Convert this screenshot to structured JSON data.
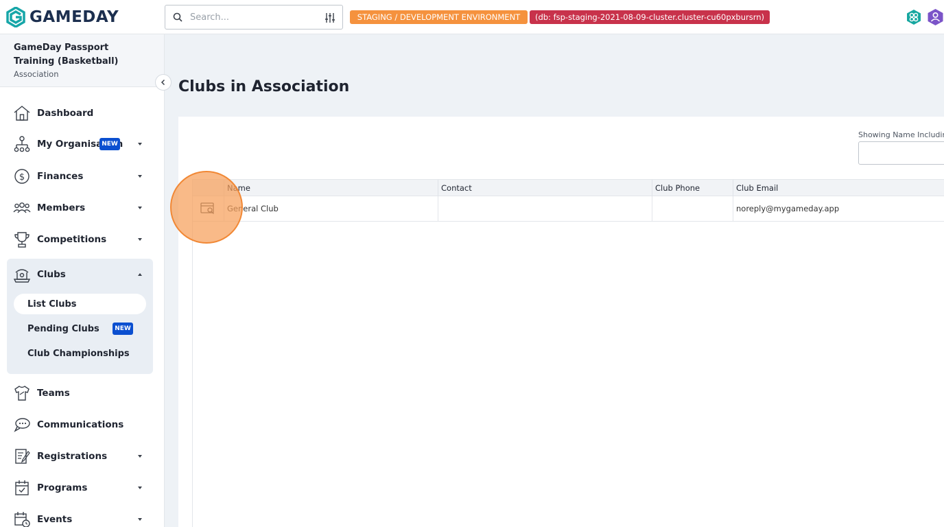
{
  "header": {
    "logo_text": "GAMEDAY",
    "search_placeholder": "Search...",
    "env_badge": "STAGING / DEVELOPMENT ENVIRONMENT",
    "db_badge": "(db: fsp-staging-2021-08-09-cluster.cluster-cu60pxbursrn)",
    "colors": {
      "env": "#f5923e",
      "db": "#c8324b",
      "brand": "#1c2f4f"
    }
  },
  "sidebar": {
    "org_name": "GameDay Passport Training (Basketball)",
    "org_type": "Association",
    "items": [
      {
        "label": "Dashboard",
        "icon": "home-icon",
        "has_caret": false
      },
      {
        "label": "My Organisation",
        "icon": "org-chart-icon",
        "badge": "NEW",
        "has_caret": true
      },
      {
        "label": "Finances",
        "icon": "dollar-icon",
        "has_caret": true
      },
      {
        "label": "Members",
        "icon": "members-icon",
        "has_caret": true
      },
      {
        "label": "Competitions",
        "icon": "trophy-icon",
        "has_caret": true
      },
      {
        "label": "Clubs",
        "icon": "clubs-icon",
        "has_caret": true,
        "expanded": true
      },
      {
        "label": "Teams",
        "icon": "jersey-icon",
        "has_caret": false
      },
      {
        "label": "Communications",
        "icon": "chat-icon",
        "has_caret": false
      },
      {
        "label": "Registrations",
        "icon": "form-icon",
        "has_caret": true
      },
      {
        "label": "Programs",
        "icon": "calendar-check-icon",
        "has_caret": true
      },
      {
        "label": "Events",
        "icon": "calendar-clock-icon",
        "has_caret": true
      }
    ],
    "clubs_sub": [
      {
        "label": "List Clubs",
        "active": true
      },
      {
        "label": "Pending Clubs",
        "badge": "NEW"
      },
      {
        "label": "Club Championships"
      }
    ]
  },
  "main": {
    "title": "Clubs in Association",
    "filter_label": "Showing Name Including",
    "filter_value": "",
    "columns": [
      "",
      "Name",
      "Contact",
      "Club Phone",
      "Club Email"
    ],
    "rows": [
      {
        "name": "General Club",
        "contact": "",
        "phone": "",
        "email": "noreply@mygameday.app"
      }
    ]
  }
}
